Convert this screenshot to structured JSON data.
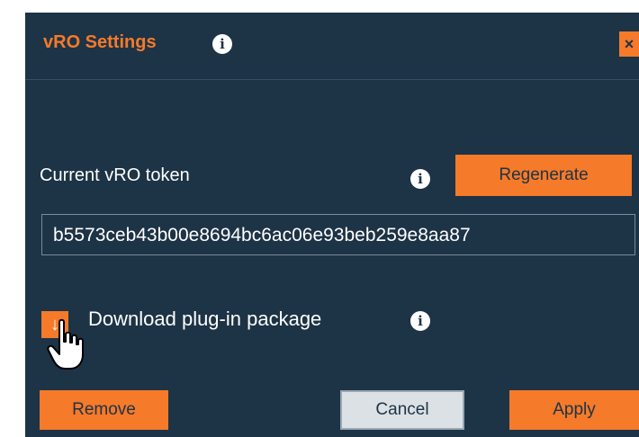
{
  "dialog": {
    "title": "vRO Settings",
    "close_label": "×",
    "accent_color": "#f57a2a",
    "background_color": "#1d3346"
  },
  "token": {
    "label": "Current vRO token",
    "regenerate_label": "Regenerate",
    "value": "b5573ceb43b00e8694bc6ac06e93beb259e8aa87"
  },
  "download": {
    "label": "Download plug-in package",
    "icon": "download-icon"
  },
  "footer": {
    "remove_label": "Remove",
    "cancel_label": "Cancel",
    "apply_label": "Apply"
  }
}
